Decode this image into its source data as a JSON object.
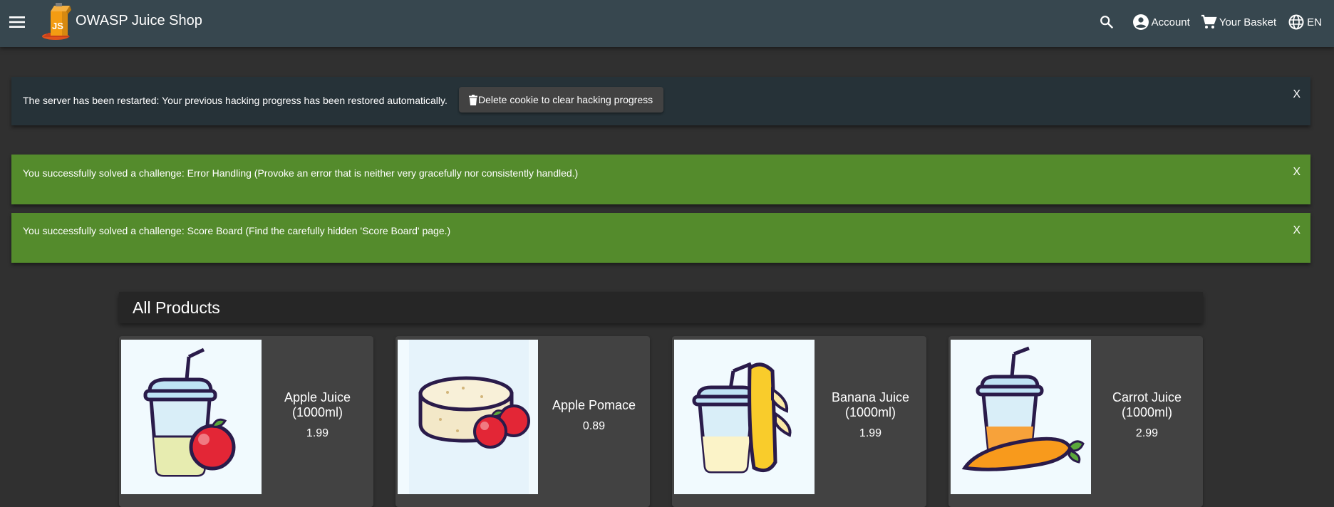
{
  "header": {
    "title": "OWASP Juice Shop",
    "logo_text": "JS",
    "account_label": "Account",
    "basket_label": "Your Basket",
    "language_label": "EN"
  },
  "notifications": {
    "restart": {
      "message": "The server has been restarted: Your previous hacking progress has been restored automatically.",
      "button_label": "Delete cookie to clear hacking progress",
      "close_label": "X"
    },
    "challenges": [
      {
        "message": "You successfully solved a challenge: Error Handling (Provoke an error that is neither very gracefully nor consistently handled.)",
        "close_label": "X"
      },
      {
        "message": "You successfully solved a challenge: Score Board (Find the carefully hidden 'Score Board' page.)",
        "close_label": "X"
      }
    ]
  },
  "products": {
    "heading": "All Products",
    "items": [
      {
        "name": "Apple Juice (1000ml)",
        "price": "1.99"
      },
      {
        "name": "Apple Pomace",
        "price": "0.89"
      },
      {
        "name": "Banana Juice (1000ml)",
        "price": "1.99"
      },
      {
        "name": "Carrot Juice (1000ml)",
        "price": "2.99"
      }
    ]
  },
  "colors": {
    "toolbar": "#37474f",
    "background": "#303030",
    "info_snackbar": "#263238",
    "success_snackbar": "#548b2c",
    "card": "#424242"
  }
}
